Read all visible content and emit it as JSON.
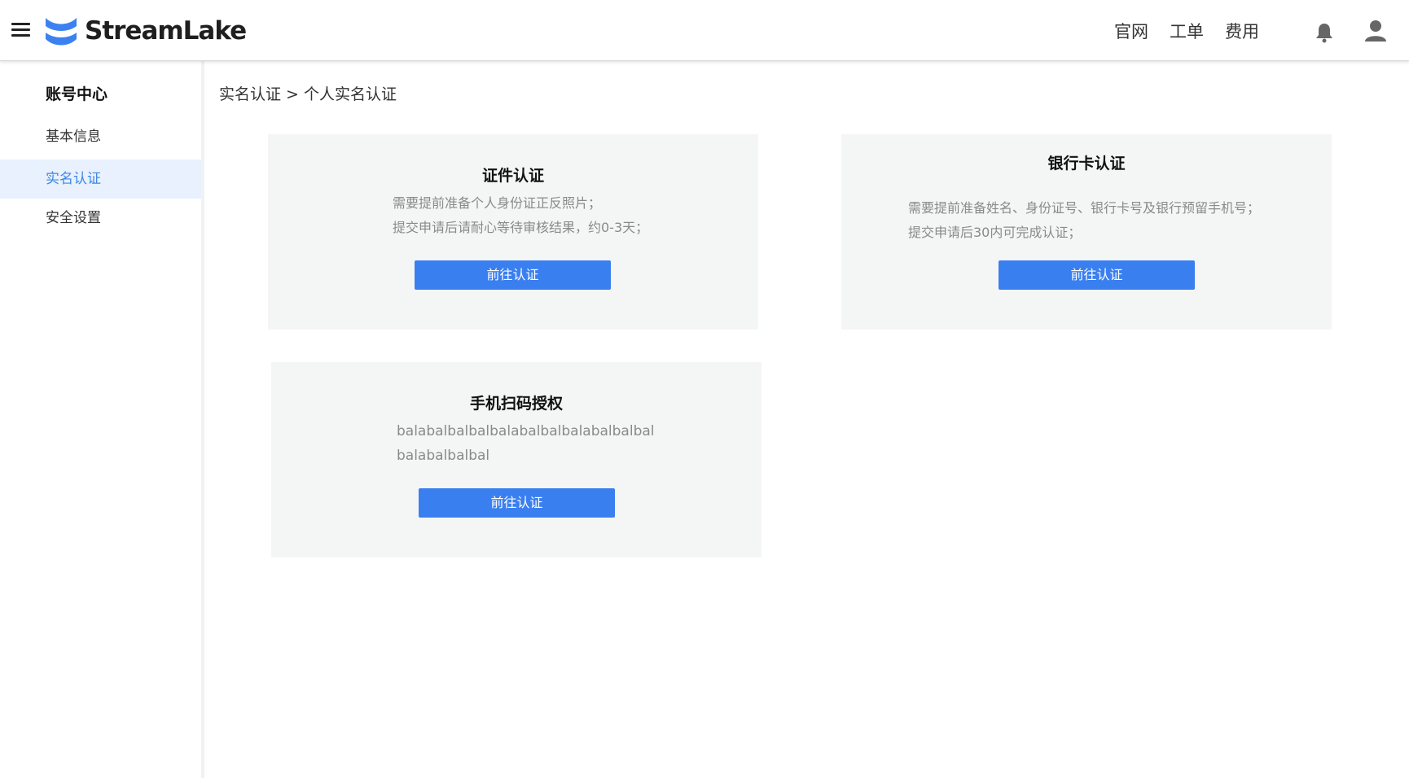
{
  "header": {
    "logo_text": "StreamLake",
    "nav": [
      "官网",
      "工单",
      "费用"
    ],
    "brand_color": "#3a7ff0"
  },
  "sidebar": {
    "title": "账号中心",
    "items": [
      {
        "label": "基本信息",
        "active": false
      },
      {
        "label": "实名认证",
        "active": true
      },
      {
        "label": "安全设置",
        "active": false
      }
    ]
  },
  "breadcrumb": "实名认证 > 个人实名认证",
  "cards": [
    {
      "title": "证件认证",
      "lines": [
        "需要提前准备个人身份证正反照片；",
        "提交申请后请耐心等待审核结果，约0-3天；"
      ],
      "button": "前往认证"
    },
    {
      "title": "银行卡认证",
      "lines": [
        "需要提前准备姓名、身份证号、银行卡号及银行预留手机号；",
        "提交申请后30内可完成认证；"
      ],
      "button": "前往认证"
    },
    {
      "title": "手机扫码授权",
      "lines": [
        "balabalbalbalbalabalbalbalabalbalbal",
        "balabalbalbal"
      ],
      "button": "前往认证"
    }
  ]
}
